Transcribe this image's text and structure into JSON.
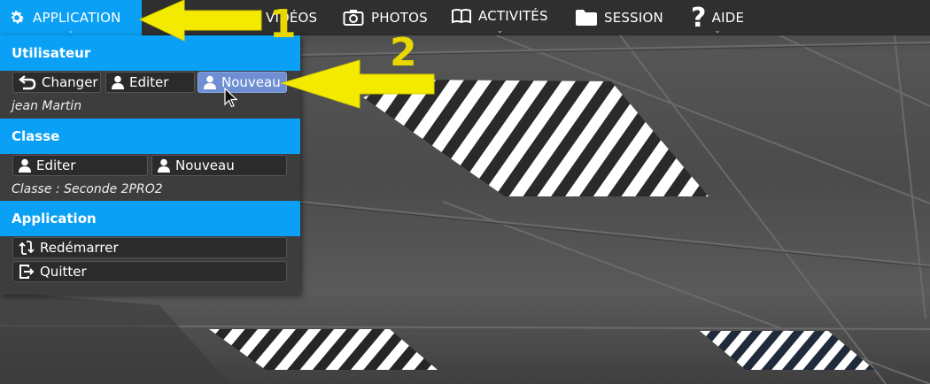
{
  "nav": {
    "items": [
      {
        "label": "APPLICATION",
        "icon": "gear-icon",
        "active": true
      },
      {
        "label": "VIDÉOS",
        "icon": "video-icon"
      },
      {
        "label": "PHOTOS",
        "icon": "camera-icon"
      },
      {
        "label": "ACTIVITÉS",
        "icon": "book-icon",
        "has_dropdown": true
      },
      {
        "label": "SESSION",
        "icon": "folder-icon"
      },
      {
        "label": "AIDE",
        "icon": "question-icon",
        "has_dropdown": true
      }
    ],
    "active_color": "#0aa0f5"
  },
  "menu": {
    "utilisateur": {
      "title": "Utilisateur",
      "buttons": [
        {
          "label": "Changer",
          "icon": "undo-icon"
        },
        {
          "label": "Editer",
          "icon": "user-icon"
        },
        {
          "label": "Nouveau",
          "icon": "user-icon",
          "selected": true
        }
      ],
      "info": "jean Martin"
    },
    "classe": {
      "title": "Classe",
      "buttons": [
        {
          "label": "Editer",
          "icon": "user-icon"
        },
        {
          "label": "Nouveau",
          "icon": "user-icon"
        }
      ],
      "info": "Classe : Seconde 2PRO2"
    },
    "application": {
      "title": "Application",
      "buttons": [
        {
          "label": "Redémarrer",
          "icon": "restart-icon"
        },
        {
          "label": "Quitter",
          "icon": "exit-icon"
        }
      ]
    }
  },
  "annotations": {
    "step1": "1",
    "step2": "2",
    "color": "#f4ea00"
  }
}
